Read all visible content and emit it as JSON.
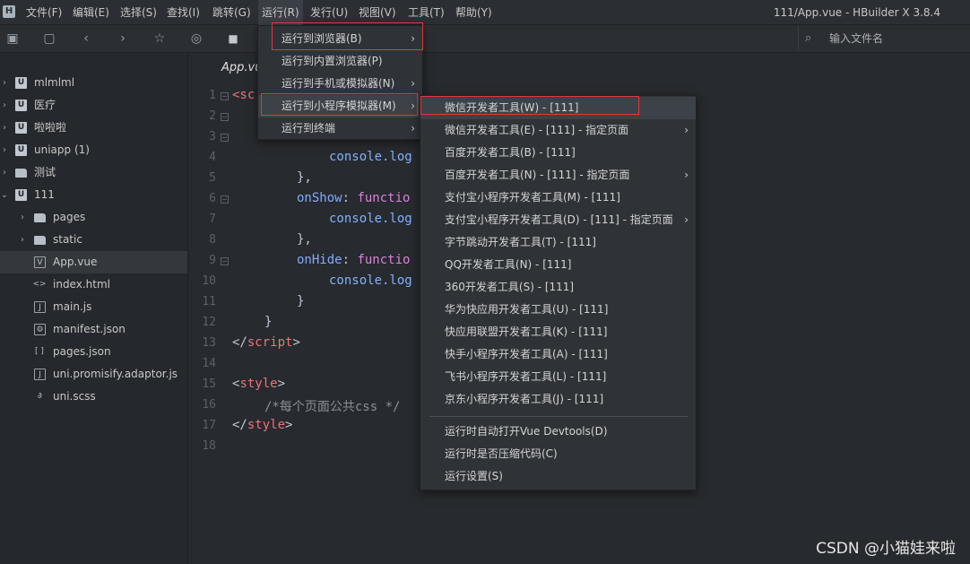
{
  "menubar": {
    "logo": "H",
    "items": [
      "文件(F)",
      "编辑(E)",
      "选择(S)",
      "查找(I)",
      "跳转(G)",
      "运行(R)",
      "发行(U)",
      "视图(V)",
      "工具(T)",
      "帮助(Y)"
    ],
    "window_title": "111/App.vue - HBuilder X 3.8.4"
  },
  "toolbar": {
    "search_placeholder": "输入文件名"
  },
  "sidebar": {
    "items": [
      {
        "label": "mlmlml",
        "type": "project"
      },
      {
        "label": "医疗",
        "type": "project"
      },
      {
        "label": "啦啦啦",
        "type": "project"
      },
      {
        "label": "uniapp (1)",
        "type": "project"
      },
      {
        "label": "测试",
        "type": "folder"
      },
      {
        "label": "111",
        "type": "project"
      },
      {
        "label": "pages",
        "type": "folder"
      },
      {
        "label": "static",
        "type": "folder"
      },
      {
        "label": "App.vue",
        "type": "vue"
      },
      {
        "label": "index.html",
        "type": "html"
      },
      {
        "label": "main.js",
        "type": "js"
      },
      {
        "label": "manifest.json",
        "type": "json"
      },
      {
        "label": "pages.json",
        "type": "json"
      },
      {
        "label": "uni.promisify.adaptor.js",
        "type": "js"
      },
      {
        "label": "uni.scss",
        "type": "scss"
      }
    ]
  },
  "editor": {
    "tab": "App.vue",
    "line_numbers": [
      "1",
      "2",
      "3",
      "4",
      "5",
      "6",
      "7",
      "8",
      "9",
      "10",
      "11",
      "12",
      "13",
      "14",
      "15",
      "16",
      "17",
      "18"
    ],
    "code": {
      "l1": "<sc",
      "l4": "console.log",
      "l5": "},",
      "l6a": "onShow",
      "l6b": ": ",
      "l6c": "functio",
      "l7": "console.log",
      "l8": "},",
      "l9a": "onHide",
      "l9b": ": ",
      "l9c": "functio",
      "l10": "console.log",
      "l11": "}",
      "l12": "}",
      "l13a": "</",
      "l13b": "script",
      "l13c": ">",
      "l15a": "<",
      "l15b": "style",
      "l15c": ">",
      "l16": "/*每个页面公共css */",
      "l17a": "</",
      "l17b": "style",
      "l17c": ">"
    }
  },
  "run_menu": {
    "items": [
      "运行到浏览器(B)",
      "运行到内置浏览器(P)",
      "运行到手机或模拟器(N)",
      "运行到小程序模拟器(M)",
      "运行到终端"
    ]
  },
  "miniprogram_menu": {
    "items": [
      "微信开发者工具(W) - [111]",
      "微信开发者工具(E) - [111] - 指定页面",
      "百度开发者工具(B) - [111]",
      "百度开发者工具(N) - [111] - 指定页面",
      "支付宝小程序开发者工具(M) - [111]",
      "支付宝小程序开发者工具(D) - [111] - 指定页面",
      "字节跳动开发者工具(T) - [111]",
      "QQ开发者工具(N) - [111]",
      "360开发者工具(S) - [111]",
      "华为快应用开发者工具(U) - [111]",
      "快应用联盟开发者工具(K) - [111]",
      "快手小程序开发者工具(A) - [111]",
      "飞书小程序开发者工具(L) - [111]",
      "京东小程序开发者工具(J) - [111]",
      "运行时自动打开Vue Devtools(D)",
      "运行时是否压缩代码(C)",
      "运行设置(S)"
    ]
  },
  "watermark": "CSDN @小猫娃来啦",
  "colors": {
    "highlight": "#e0393e",
    "background": "#272a2e",
    "menu_bg": "#2f3338"
  }
}
